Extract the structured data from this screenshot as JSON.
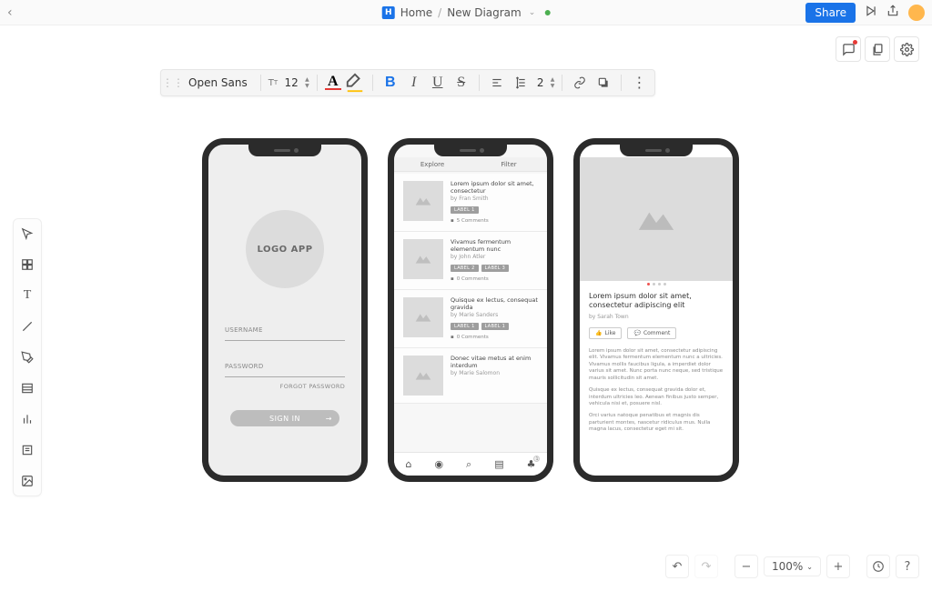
{
  "topbar": {
    "home_label": "Home",
    "doc_name": "New Diagram",
    "share_label": "Share"
  },
  "format": {
    "font": "Open Sans",
    "size": "12",
    "lineheight": "2"
  },
  "status": {
    "zoom": "100%"
  },
  "phone1": {
    "logo": "LOGO APP",
    "username": "USERNAME",
    "password": "PASSWORD",
    "forgot": "FORGOT PASSWORD",
    "signin": "SIGN IN"
  },
  "phone2": {
    "tab_explore": "Explore",
    "tab_filter": "Filter",
    "items": [
      {
        "title": "Lorem ipsum dolor sit amet, consectetur",
        "author": "by Fran Smith",
        "labels": [
          "LABEL 1"
        ],
        "comments": "5 Comments"
      },
      {
        "title": "Vivamus fermentum elementum nunc",
        "author": "by John Atler",
        "labels": [
          "LABEL 2",
          "LABEL 3"
        ],
        "comments": "0 Comments"
      },
      {
        "title": "Quisque ex lectus, consequat gravida",
        "author": "by Marie Sanders",
        "labels": [
          "LABEL 1",
          "LABEL 1"
        ],
        "comments": "0 Comments"
      },
      {
        "title": "Donec vitae metus at enim interdum",
        "author": "by Marie Salomon",
        "labels": [],
        "comments": ""
      }
    ],
    "badge": "1"
  },
  "phone3": {
    "title": "Lorem ipsum dolor sit amet, consectetur adipiscing elit",
    "author": "by Sarah Town",
    "like": "Like",
    "comment": "Comment",
    "para1": "Lorem ipsum dolor sit amet, consectetur adipiscing elit. Vivamus fermentum elementum nunc a ultricies. Vivamus mollis faucibus ligula, a imperdiet dolor varius sit amet. Nunc porta nunc neque, sed tristique mauris sollicitudin sit amet.",
    "para2": "Quisque ex lectus, consequat gravida dolor et, interdum ultricies leo. Aenean finibus justo semper, vehicula nisi et, posuere nisl.",
    "para3": "Orci varius natoque penatibus et magnis dis parturient montes, nascetur ridiculus mus. Nulla magna lacus, consectetur eget mi sit."
  }
}
